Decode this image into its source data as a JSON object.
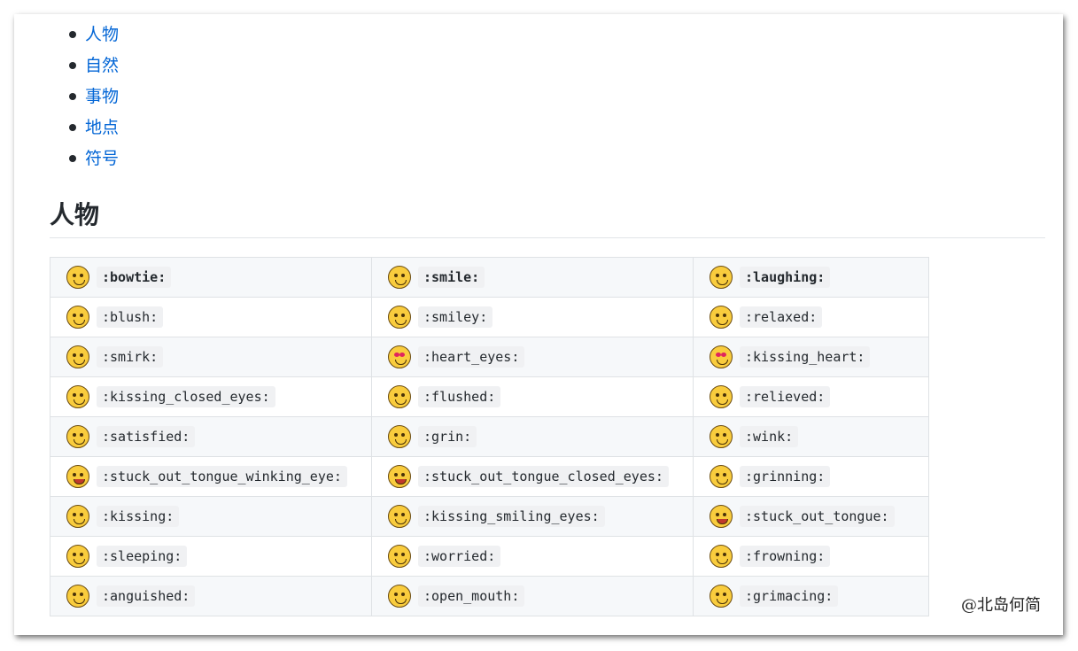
{
  "toc": [
    "人物",
    "自然",
    "事物",
    "地点",
    "符号"
  ],
  "section_title": "人物",
  "rows": [
    [
      {
        "icon": "bowtie-icon",
        "code": ":bowtie:"
      },
      {
        "icon": "smile-icon",
        "code": ":smile:"
      },
      {
        "icon": "laughing-icon",
        "code": ":laughing:"
      }
    ],
    [
      {
        "icon": "blush-icon",
        "code": ":blush:"
      },
      {
        "icon": "smiley-icon",
        "code": ":smiley:"
      },
      {
        "icon": "relaxed-icon",
        "code": ":relaxed:"
      }
    ],
    [
      {
        "icon": "smirk-icon",
        "code": ":smirk:"
      },
      {
        "icon": "heart-eyes-icon",
        "code": ":heart_eyes:"
      },
      {
        "icon": "kissing-heart-icon",
        "code": ":kissing_heart:"
      }
    ],
    [
      {
        "icon": "kissing-closed-eyes-icon",
        "code": ":kissing_closed_eyes:"
      },
      {
        "icon": "flushed-icon",
        "code": ":flushed:"
      },
      {
        "icon": "relieved-icon",
        "code": ":relieved:"
      }
    ],
    [
      {
        "icon": "satisfied-icon",
        "code": ":satisfied:"
      },
      {
        "icon": "grin-icon",
        "code": ":grin:"
      },
      {
        "icon": "wink-icon",
        "code": ":wink:"
      }
    ],
    [
      {
        "icon": "tongue-winking-eye-icon",
        "code": ":stuck_out_tongue_winking_eye:"
      },
      {
        "icon": "tongue-closed-eyes-icon",
        "code": ":stuck_out_tongue_closed_eyes:"
      },
      {
        "icon": "grinning-icon",
        "code": ":grinning:"
      }
    ],
    [
      {
        "icon": "kissing-icon",
        "code": ":kissing:"
      },
      {
        "icon": "kissing-smiling-eyes-icon",
        "code": ":kissing_smiling_eyes:"
      },
      {
        "icon": "stuck-out-tongue-icon",
        "code": ":stuck_out_tongue:"
      }
    ],
    [
      {
        "icon": "sleeping-icon",
        "code": ":sleeping:"
      },
      {
        "icon": "worried-icon",
        "code": ":worried:"
      },
      {
        "icon": "frowning-icon",
        "code": ":frowning:"
      }
    ],
    [
      {
        "icon": "anguished-icon",
        "code": ":anguished:"
      },
      {
        "icon": "open-mouth-icon",
        "code": ":open_mouth:"
      },
      {
        "icon": "grimacing-icon",
        "code": ":grimacing:"
      }
    ]
  ],
  "watermark": "@北岛何简"
}
